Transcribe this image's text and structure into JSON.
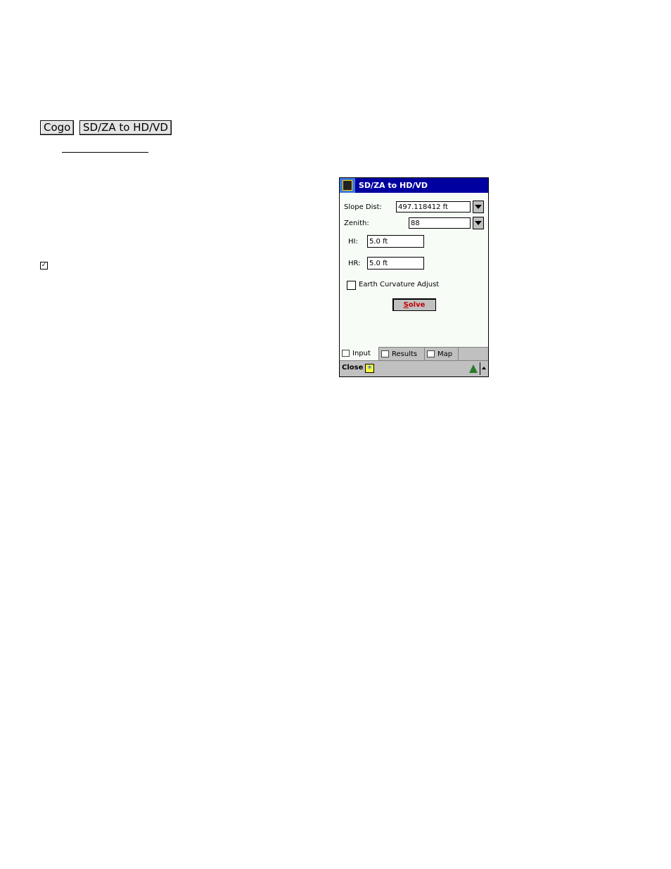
{
  "breadcrumb": [
    "Cogo",
    "SD/ZA to HD/VD"
  ],
  "doc_checkmark": "☑",
  "dialog": {
    "title": "SD/ZA to HD/VD",
    "fields": {
      "slope_dist_label": "Slope Dist:",
      "slope_dist_value": "497.118412 ft",
      "zenith_label": "Zenith:",
      "zenith_value": "88",
      "hi_label": "HI:",
      "hi_value": "5.0 ft",
      "hr_label": "HR:",
      "hr_value": "5.0 ft"
    },
    "earth_curvature_label": "Earth Curvature Adjust",
    "earth_curvature_checked": false,
    "solve_label_first": "S",
    "solve_label_rest": "olve",
    "tabs": [
      "Input",
      "Results",
      "Map"
    ],
    "active_tab": "Input",
    "menubar": {
      "close_label": "Close",
      "sip_glyph": "✳"
    }
  }
}
